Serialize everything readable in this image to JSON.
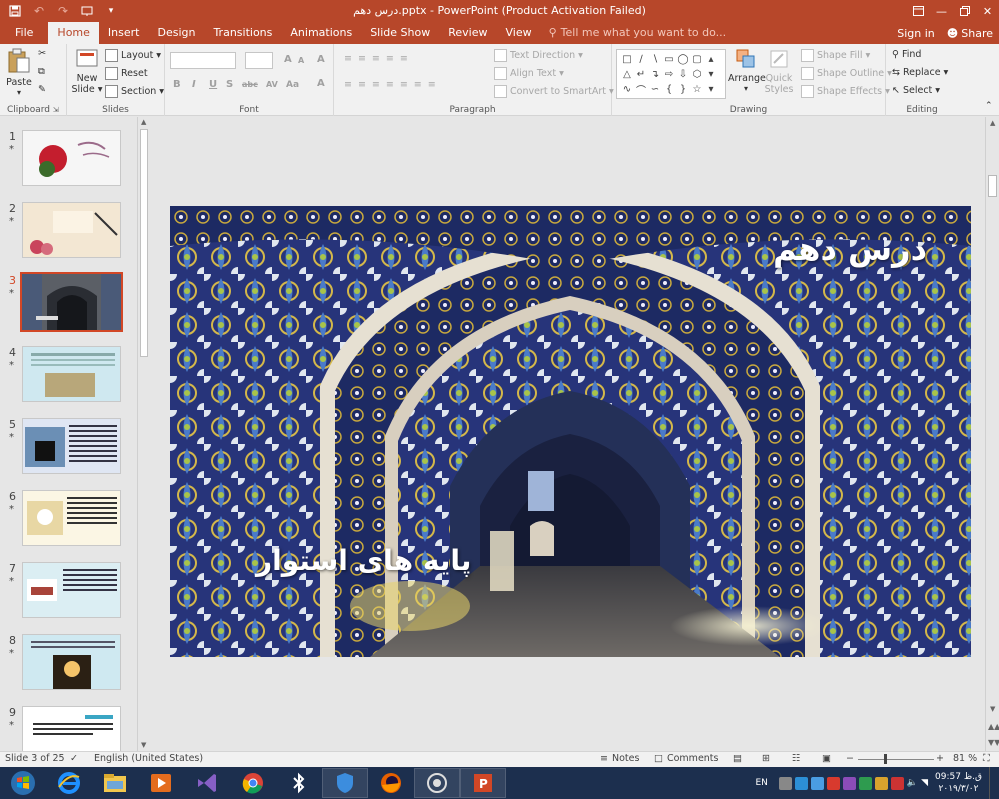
{
  "titlebar": {
    "title": "درس دهم.pptx - PowerPoint (Product Activation Failed)",
    "quick_access": [
      "save-icon",
      "undo-icon",
      "redo-icon",
      "presenter-icon",
      "qat-dropdown-icon"
    ],
    "window_controls": [
      "ribbon-display-icon",
      "minimize-icon",
      "restore-icon",
      "close-icon"
    ]
  },
  "tabs": {
    "items": [
      "File",
      "Home",
      "Insert",
      "Design",
      "Transitions",
      "Animations",
      "Slide Show",
      "Review",
      "View"
    ],
    "active": "Home",
    "tell_me": "Tell me what you want to do...",
    "sign_in": "Sign in",
    "share": "Share"
  },
  "ribbon": {
    "clipboard": {
      "label": "Clipboard",
      "paste": "Paste"
    },
    "slides": {
      "label": "Slides",
      "new_slide": "New",
      "new_slide2": "Slide",
      "layout": "Layout",
      "reset": "Reset",
      "section": "Section"
    },
    "font": {
      "label": "Font",
      "bold": "B",
      "italic": "I",
      "underline": "U",
      "shadow": "S",
      "strike": "abc",
      "spacing": "AV",
      "case": "Aa",
      "grow": "A",
      "shrink": "A",
      "clear": "A",
      "color": "A"
    },
    "paragraph": {
      "label": "Paragraph",
      "text_direction": "Text Direction",
      "align_text": "Align Text",
      "convert_smartart": "Convert to SmartArt"
    },
    "drawing": {
      "label": "Drawing",
      "arrange": "Arrange",
      "quick_styles": "Quick",
      "quick_styles2": "Styles",
      "shape_fill": "Shape Fill",
      "shape_outline": "Shape Outline",
      "shape_effects": "Shape Effects"
    },
    "editing": {
      "label": "Editing",
      "find": "Find",
      "replace": "Replace",
      "select": "Select"
    }
  },
  "thumbnails": [
    {
      "num": "1",
      "star": "*"
    },
    {
      "num": "2",
      "star": "*"
    },
    {
      "num": "3",
      "star": "*"
    },
    {
      "num": "4",
      "star": "*"
    },
    {
      "num": "5",
      "star": "*"
    },
    {
      "num": "6",
      "star": "*"
    },
    {
      "num": "7",
      "star": "*"
    },
    {
      "num": "8",
      "star": "*"
    },
    {
      "num": "9",
      "star": "*"
    }
  ],
  "selected_slide": 3,
  "slide": {
    "title": "درس دهم",
    "subtitle": "پایه های استوار"
  },
  "statusbar": {
    "slide_info": "Slide 3 of 25",
    "language": "English (United States)",
    "notes": "Notes",
    "comments": "Comments",
    "zoom": "81 %"
  },
  "taskbar": {
    "apps": [
      "start-icon",
      "ie-icon",
      "explorer-icon",
      "media-icon",
      "visual-studio-icon",
      "chrome-icon",
      "bluetooth-icon",
      "shield-icon",
      "firefox-icon",
      "vpn-icon",
      "powerpoint-icon"
    ],
    "lang": "EN",
    "time": "09:57 ق.ظ",
    "date": "۲۰۱۹/۳/۰۲"
  },
  "colors": {
    "brand": "#b7472a",
    "accent": "#d24726",
    "taskbar": "#1c2f4e"
  }
}
